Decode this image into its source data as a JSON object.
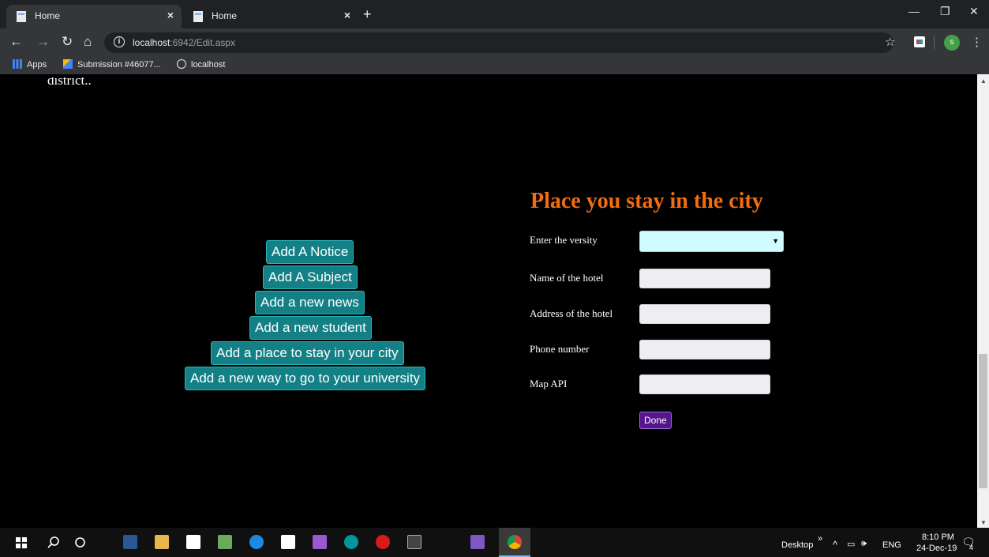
{
  "browser": {
    "tabs": [
      {
        "title": "Home",
        "active": true
      },
      {
        "title": "Home",
        "active": false
      }
    ],
    "url": {
      "host": "localhost",
      "path": ":6942/Edit.aspx"
    },
    "bookmarks": [
      {
        "label": "Apps",
        "icon": "apps-icon"
      },
      {
        "label": "Submission #46077...",
        "icon": "submission-icon"
      },
      {
        "label": "localhost",
        "icon": "globe-icon"
      }
    ],
    "profile_initial": "s"
  },
  "page": {
    "cut_text": "district..",
    "menu_buttons": [
      "Add A Notice",
      "Add A Subject",
      "Add a new news",
      "Add a new student",
      "Add a place to stay in your city",
      "Add a new way to go to your university"
    ],
    "form": {
      "title": "Place you stay in the city",
      "fields": [
        {
          "label": "Enter the versity",
          "type": "select",
          "value": ""
        },
        {
          "label": "Name of the hotel",
          "type": "text",
          "value": ""
        },
        {
          "label": "Address of the hotel",
          "type": "text",
          "value": ""
        },
        {
          "label": "Phone number",
          "type": "text",
          "value": ""
        },
        {
          "label": "Map API",
          "type": "text",
          "value": ""
        }
      ],
      "submit_label": "Done"
    }
  },
  "taskbar": {
    "desktop_label": "Desktop",
    "language": "ENG",
    "time": "8:10 PM",
    "date": "24-Dec-19",
    "notification_count": "4"
  },
  "colors": {
    "form_title": "#f26d0f",
    "menu_button": "#138085",
    "done_button": "#55168b",
    "select_bg": "#cffcff"
  }
}
